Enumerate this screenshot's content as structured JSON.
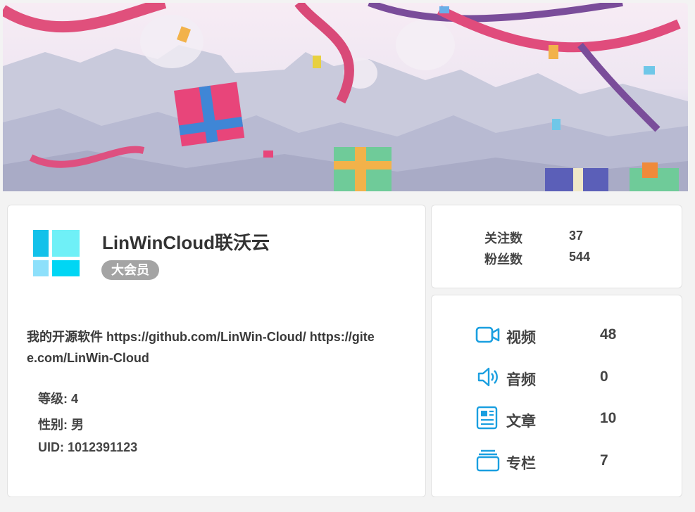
{
  "profile": {
    "username": "LinWinCloud联沃云",
    "vip_badge": "大会员",
    "bio": "我的开源软件 https://github.com/LinWin-Cloud/ https://gitee.com/LinWin-Cloud",
    "level": "等级: 4",
    "gender": "性别: 男",
    "uid": "UID: 1012391123"
  },
  "follow": {
    "following_label": "关注数",
    "following_value": "37",
    "followers_label": "粉丝数",
    "followers_value": "544"
  },
  "stats": [
    {
      "icon": "video-camera-icon",
      "label": "视频",
      "value": "48"
    },
    {
      "icon": "speaker-icon",
      "label": "音频",
      "value": "0"
    },
    {
      "icon": "article-icon",
      "label": "文章",
      "value": "10"
    },
    {
      "icon": "column-icon",
      "label": "专栏",
      "value": "7"
    }
  ],
  "colors": {
    "accent": "#1a9fe0",
    "logo_tiles": [
      "#13c1ea",
      "#6ff0f7",
      "#8de0fb",
      "#00d6f4"
    ],
    "badge": "#a4a4a4"
  }
}
